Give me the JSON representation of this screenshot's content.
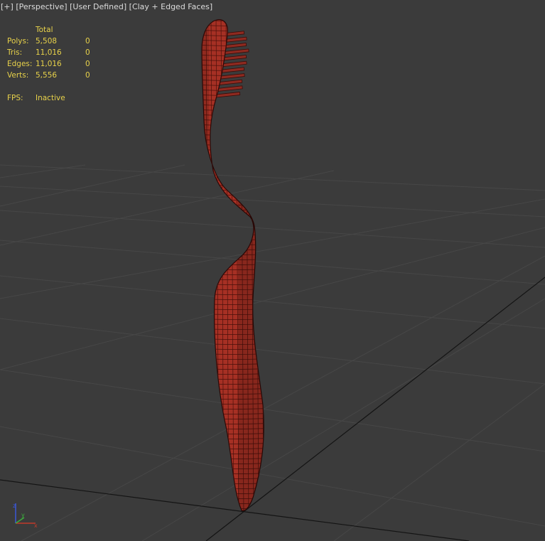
{
  "viewport_menu": {
    "plus": "[+]",
    "view": "[Perspective]",
    "shading": "[User Defined]",
    "style": "[Clay + Edged Faces]"
  },
  "stats": {
    "header": "Total",
    "rows": [
      {
        "label": "Polys:",
        "total": "5,508",
        "selected": "0"
      },
      {
        "label": "Tris:",
        "total": "11,016",
        "selected": "0"
      },
      {
        "label": "Edges:",
        "total": "11,016",
        "selected": "0"
      },
      {
        "label": "Verts:",
        "total": "5,556",
        "selected": "0"
      }
    ],
    "fps_label": "FPS:",
    "fps_value": "Inactive"
  },
  "axis": {
    "z": "z",
    "y": "y",
    "x": "x"
  },
  "colors": {
    "background": "#3b3b3b",
    "grid": "#4a4a4a",
    "grid_main": "#151515",
    "stats_text": "#e8d24a",
    "model_fill": "#a83226",
    "model_edge": "#3a0c08"
  },
  "scene": {
    "object": "toothbrush-mesh"
  }
}
